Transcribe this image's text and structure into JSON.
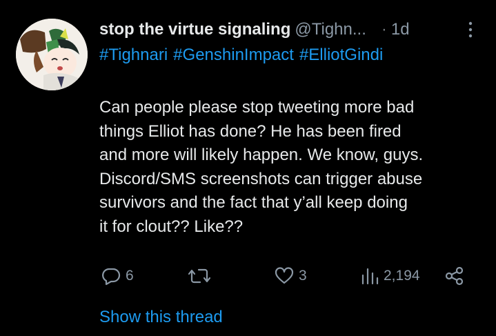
{
  "tweet": {
    "display_name": "stop the virtue signaling",
    "handle": "@Tighn...",
    "separator": "·",
    "time": "1d",
    "hashtags": [
      "#Tighnari",
      "#GenshinImpact",
      "#ElliotGindi"
    ],
    "body_lines": [
      "Can people please stop tweeting more bad",
      "things Elliot has done? He has been fired",
      "and more will likely happen. We know, guys.",
      "Discord/SMS screenshots can trigger abuse",
      "survivors and the fact that y’all keep doing",
      "it for clout?? Like??"
    ],
    "show_thread": "Show this thread"
  },
  "actions": {
    "replies": "6",
    "retweets": "",
    "likes": "3",
    "views": "2,194"
  },
  "icons": {
    "reply": "reply-bubble-icon",
    "retweet": "retweet-icon",
    "like": "heart-icon",
    "views": "bar-chart-icon",
    "share": "share-icon",
    "more": "more-vertical-icon"
  },
  "colors": {
    "background": "#000000",
    "text": "#e7e9ea",
    "secondary": "#8b98a5",
    "link": "#1d9bf0"
  }
}
